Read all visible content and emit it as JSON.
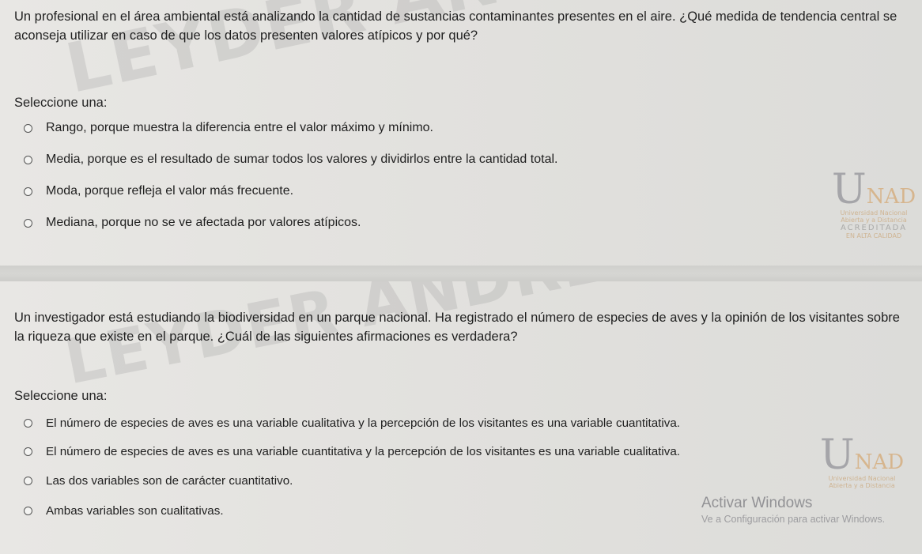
{
  "questions": [
    {
      "text": "Un profesional en el área ambiental está analizando la cantidad de sustancias contaminantes presentes en el aire. ¿Qué medida de tendencia central se aconseja utilizar en caso de que los datos presenten valores atípicos y por qué?",
      "prompt": "Seleccione una:",
      "options": [
        "Rango, porque muestra la diferencia entre el valor máximo y mínimo.",
        "Media, porque es el resultado de sumar todos los valores y dividirlos entre la cantidad total.",
        "Moda, porque refleja el valor más frecuente.",
        "Mediana, porque no se ve afectada por valores atípicos."
      ]
    },
    {
      "text": "Un investigador está estudiando la biodiversidad en un parque nacional. Ha registrado el número de especies de aves y la opinión de los visitantes sobre la riqueza que existe en el parque. ¿Cuál de las siguientes afirmaciones es verdadera?",
      "prompt": "Seleccione una:",
      "options": [
        "El número de especies de aves es una variable cualitativa y la percepción de los visitantes es una variable cuantitativa.",
        "El número de especies de aves es una variable cuantitativa y la percepción de los visitantes es una variable cualitativa.",
        "Las dos variables son de carácter cuantitativo.",
        "Ambas variables son cualitativas."
      ]
    }
  ],
  "watermark": {
    "name_top": "LEYDER ANDRES RIOS VALENCIA",
    "logo_u": "U",
    "logo_nad": "NAD",
    "logo_line1": "Universidad Nacional",
    "logo_line2": "Abierta y a Distancia",
    "logo_acred": "ACREDITADA",
    "logo_acred_sub": "EN ALTA CALIDAD"
  },
  "activate_windows": {
    "title": "Activar Windows",
    "subtitle": "Ve a Configuración para activar Windows."
  },
  "colors": {
    "background": "#e3e3e0",
    "text": "#1f1f1f",
    "watermark": "#969696",
    "logo_accent": "#d29650"
  }
}
